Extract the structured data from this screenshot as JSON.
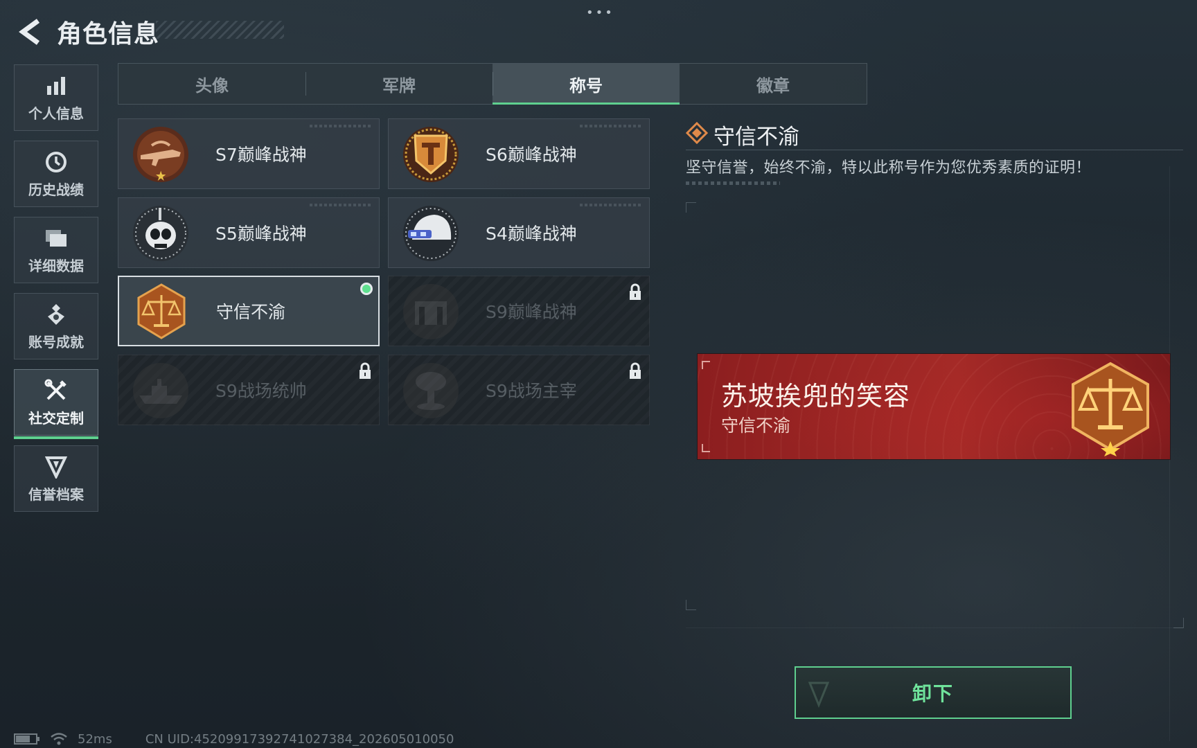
{
  "header": {
    "title": "角色信息",
    "more_glyph": "•••"
  },
  "sidebar": {
    "items": [
      {
        "label": "个人信息",
        "icon": "bar-chart-icon",
        "active": false
      },
      {
        "label": "历史战绩",
        "icon": "history-clock-icon",
        "active": false
      },
      {
        "label": "详细数据",
        "icon": "folder-icon",
        "active": false
      },
      {
        "label": "账号成就",
        "icon": "medal-icon",
        "active": false
      },
      {
        "label": "社交定制",
        "icon": "tools-icon",
        "active": true
      },
      {
        "label": "信誉档案",
        "icon": "credit-shield-icon",
        "active": false
      }
    ]
  },
  "tabs": [
    {
      "label": "头像",
      "active": false
    },
    {
      "label": "军牌",
      "active": false
    },
    {
      "label": "称号",
      "active": true
    },
    {
      "label": "徽章",
      "active": false
    }
  ],
  "titles": [
    {
      "label": "S7巅峰战神",
      "emblem": "rifle-emblem",
      "locked": false,
      "equipped": false
    },
    {
      "label": "S6巅峰战神",
      "emblem": "shield-t-emblem",
      "locked": false,
      "equipped": false
    },
    {
      "label": "S5巅峰战神",
      "emblem": "skull-mask-emblem",
      "locked": false,
      "equipped": false
    },
    {
      "label": "S4巅峰战神",
      "emblem": "helmet-emblem",
      "locked": false,
      "equipped": false
    },
    {
      "label": "守信不渝",
      "emblem": "scales-emblem",
      "locked": false,
      "equipped": true
    },
    {
      "label": "S9巅峰战神",
      "emblem": "fortress-emblem",
      "locked": true,
      "equipped": false
    },
    {
      "label": "S9战场统帅",
      "emblem": "warship-emblem",
      "locked": true,
      "equipped": false
    },
    {
      "label": "S9战场主宰",
      "emblem": "mushroom-cloud-emblem",
      "locked": true,
      "equipped": false
    }
  ],
  "detail": {
    "title": "守信不渝",
    "description": "坚守信誉，始终不渝，特以此称号作为您优秀素质的证明！"
  },
  "banner": {
    "player_name": "苏坡挨兜的笑容",
    "title": "守信不渝"
  },
  "unequip_label": "卸下",
  "status_bar": {
    "ping": "52ms",
    "uid": "CN UID:4520991739274102​7384_202605010050"
  },
  "colors": {
    "accent_green": "#5fd08f",
    "banner_red": "#a52a27",
    "emblem_bronze": "#b5682e"
  }
}
